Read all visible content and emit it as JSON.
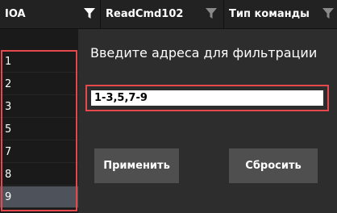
{
  "header": {
    "columns": [
      {
        "label": "IOA"
      },
      {
        "label": "ReadCmd102"
      },
      {
        "label": "Тип команды"
      }
    ]
  },
  "list": {
    "items": [
      "1",
      "2",
      "3",
      "5",
      "7",
      "8",
      "9"
    ],
    "selected": "9"
  },
  "filter_panel": {
    "title": "Введите адреса для фильтрации",
    "input_value": "1-3,5,7-9",
    "apply_label": "Применить",
    "reset_label": "Сбросить"
  },
  "colors": {
    "highlight": "#e5484d",
    "panel_bg": "#2d2d2d",
    "button_bg": "#4f4f4f",
    "selected_row": "#4e525a"
  }
}
